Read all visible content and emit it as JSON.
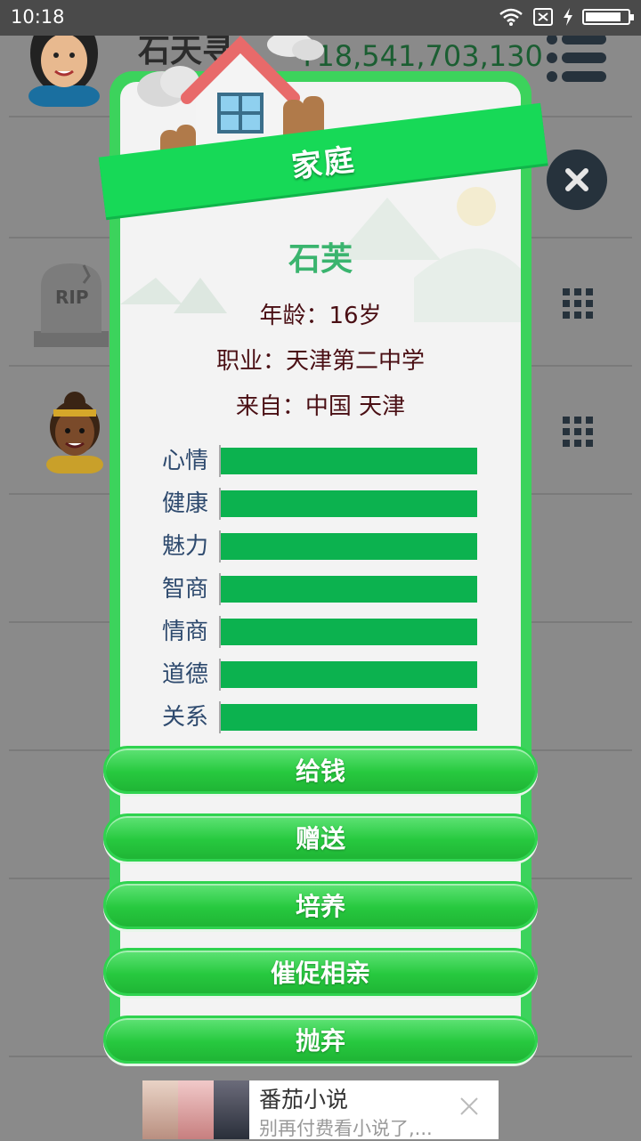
{
  "status_bar": {
    "time": "10:18",
    "battery_level": 0.85
  },
  "background": {
    "player_name": "石天寻",
    "money": "¥18,541,703,130",
    "rip_text": "RIP"
  },
  "modal": {
    "header": "家庭",
    "person": {
      "name": "石芙",
      "age_line": "年龄：16岁",
      "job_line": "职业：天津第二中学",
      "from_line": "来自：中国 天津"
    },
    "stats": [
      {
        "label": "心情",
        "value": 1.0
      },
      {
        "label": "健康",
        "value": 1.0
      },
      {
        "label": "魅力",
        "value": 1.0
      },
      {
        "label": "智商",
        "value": 1.0
      },
      {
        "label": "情商",
        "value": 1.0
      },
      {
        "label": "道德",
        "value": 1.0
      },
      {
        "label": "关系",
        "value": 1.0
      }
    ],
    "buttons": [
      "给钱",
      "赠送",
      "培养",
      "催促相亲",
      "抛弃"
    ]
  },
  "ad": {
    "title": "番茄小说",
    "subtitle": "别再付费看小说了,..."
  },
  "colors": {
    "accent": "#17d957",
    "bar": "#0cb24f",
    "name": "#3ab46e"
  }
}
